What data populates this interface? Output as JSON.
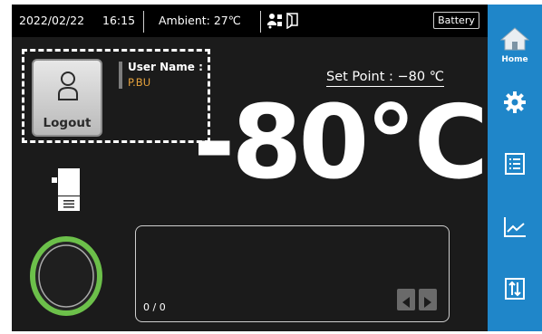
{
  "status_bar": {
    "date": "2022/02/22",
    "time": "16:15",
    "ambient": "Ambient: 27℃",
    "battery": "Battery",
    "icons": [
      "user-key-icon",
      "door-icon"
    ]
  },
  "user": {
    "logout_label": "Logout",
    "name_label": "User Name :",
    "name_value": "P.BU"
  },
  "set_point": "Set Point : −80  ℃",
  "current_temp": "-80℃",
  "messages": {
    "counter": "0 / 0"
  },
  "sidebar": {
    "home_label": "Home",
    "items": [
      "home-icon",
      "settings-icon",
      "list-icon",
      "chart-icon",
      "sort-icon"
    ]
  },
  "colors": {
    "sidebar": "#1f86c9",
    "user_name": "#e6a23c",
    "ring": "#6cc04a",
    "background": "#1b1b1b"
  }
}
